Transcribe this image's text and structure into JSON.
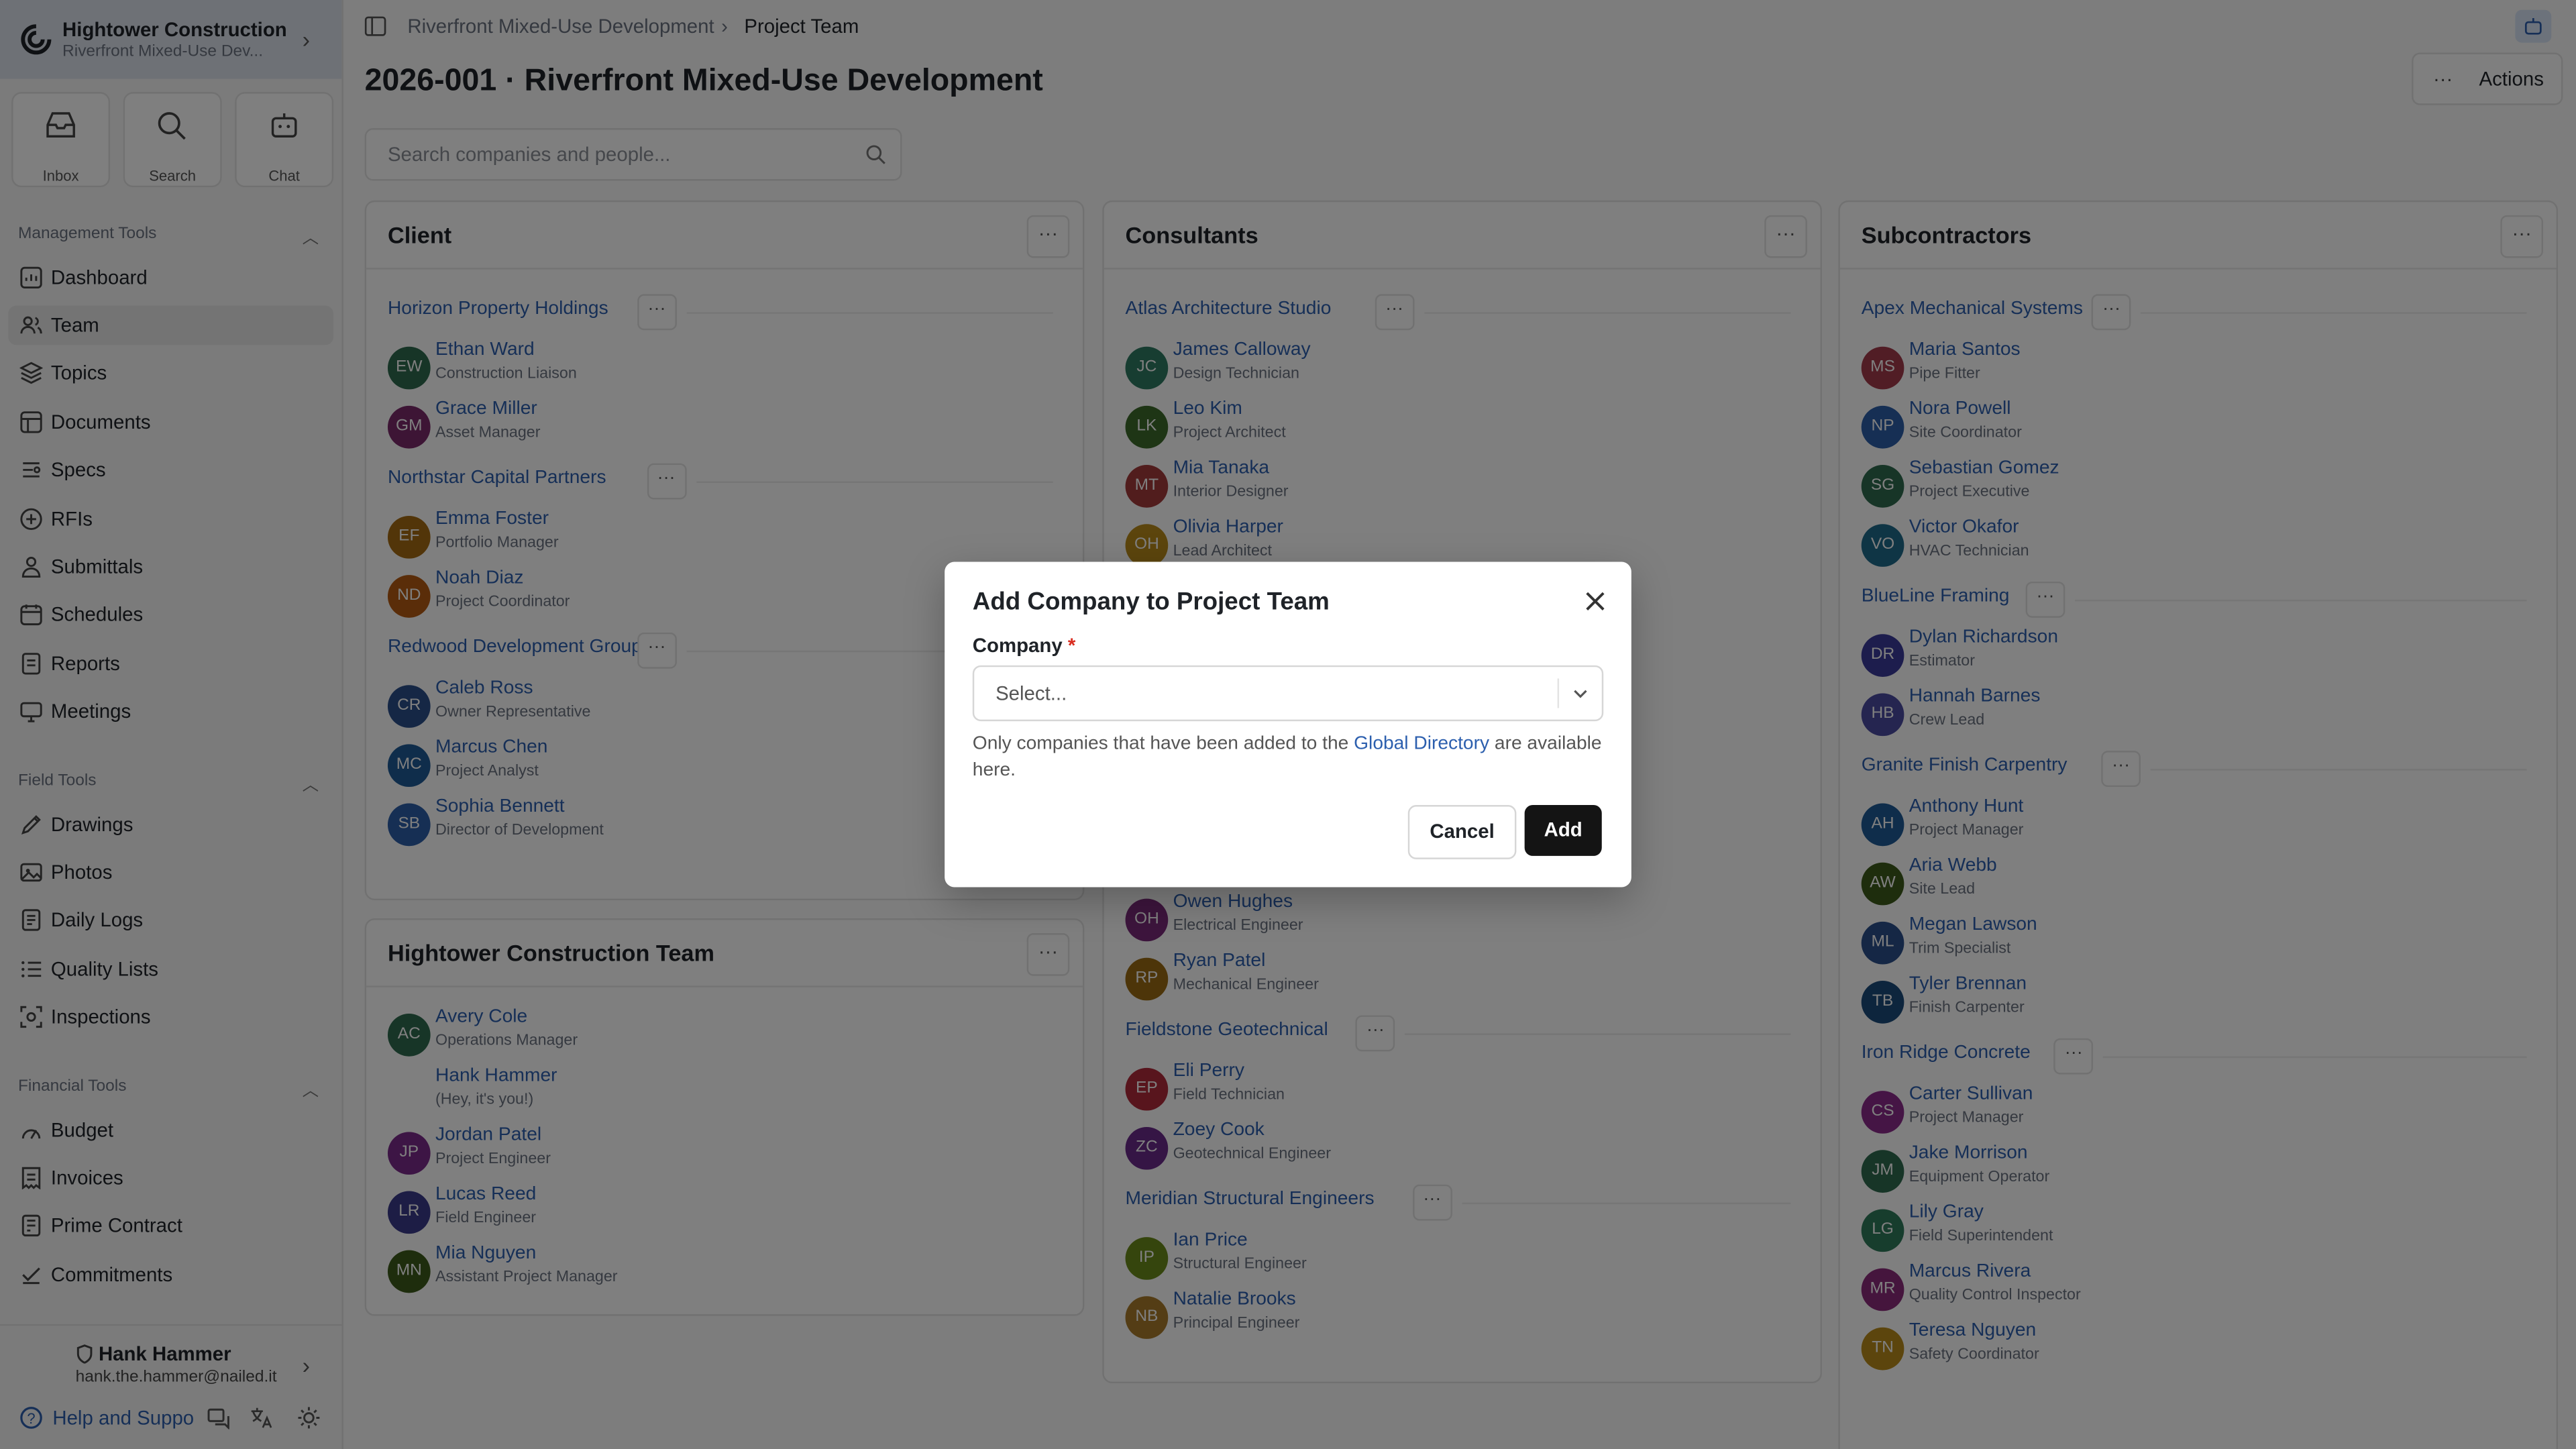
{
  "org": {
    "name": "Hightower Construction",
    "project_short": "Riverfront Mixed-Use Dev..."
  },
  "quick_actions": [
    {
      "label": "Inbox",
      "icon": "inbox-icon"
    },
    {
      "label": "Search",
      "icon": "search-icon"
    },
    {
      "label": "Chat",
      "icon": "bot-icon"
    }
  ],
  "sidebar": {
    "management": {
      "title": "Management Tools",
      "items": [
        {
          "label": "Dashboard",
          "icon": "dashboard-icon"
        },
        {
          "label": "Team",
          "icon": "users-icon",
          "active": true
        },
        {
          "label": "Topics",
          "icon": "layers-icon"
        },
        {
          "label": "Documents",
          "icon": "documents-icon"
        },
        {
          "label": "Specs",
          "icon": "specs-icon"
        },
        {
          "label": "RFIs",
          "icon": "rfi-icon"
        },
        {
          "label": "Submittals",
          "icon": "submittals-icon"
        },
        {
          "label": "Schedules",
          "icon": "calendar-icon"
        },
        {
          "label": "Reports",
          "icon": "reports-icon"
        },
        {
          "label": "Meetings",
          "icon": "meetings-icon"
        }
      ]
    },
    "field": {
      "title": "Field Tools",
      "items": [
        {
          "label": "Drawings",
          "icon": "drawings-icon"
        },
        {
          "label": "Photos",
          "icon": "photos-icon"
        },
        {
          "label": "Daily Logs",
          "icon": "daily-logs-icon"
        },
        {
          "label": "Quality Lists",
          "icon": "list-icon"
        },
        {
          "label": "Inspections",
          "icon": "inspections-icon"
        }
      ]
    },
    "financial": {
      "title": "Financial Tools",
      "items": [
        {
          "label": "Budget",
          "icon": "budget-icon"
        },
        {
          "label": "Invoices",
          "icon": "invoices-icon"
        },
        {
          "label": "Prime Contract",
          "icon": "contract-icon"
        },
        {
          "label": "Commitments",
          "icon": "commitments-icon"
        }
      ]
    }
  },
  "user": {
    "name": "Hank Hammer",
    "email": "hank.the.hammer@nailed.it",
    "help_label": "Help and Suppo"
  },
  "breadcrumb": {
    "project": "Riverfront Mixed-Use Development",
    "current": "Project Team"
  },
  "page_title": "2026-001 · Riverfront Mixed-Use Development",
  "actions_label": "Actions",
  "search_placeholder": "Search companies and people...",
  "columns": [
    {
      "title": "Client",
      "companies": [
        {
          "name": "Horizon Property Holdings",
          "people": [
            {
              "i": "EW",
              "n": "Ethan Ward",
              "r": "Construction Liaison",
              "c": "#2f6b4f"
            },
            {
              "i": "GM",
              "n": "Grace Miller",
              "r": "Asset Manager",
              "c": "#7a2a6a"
            }
          ]
        },
        {
          "name": "Northstar Capital Partners",
          "people": [
            {
              "i": "EF",
              "n": "Emma Foster",
              "r": "Portfolio Manager",
              "c": "#a46a12"
            },
            {
              "i": "ND",
              "n": "Noah Diaz",
              "r": "Project Coordinator",
              "c": "#b45a12"
            }
          ]
        },
        {
          "name": "Redwood Development Group",
          "people": [
            {
              "i": "CR",
              "n": "Caleb Ross",
              "r": "Owner Representative",
              "c": "#2b4f8a"
            },
            {
              "i": "MC",
              "n": "Marcus Chen",
              "r": "Project Analyst",
              "c": "#1f5a96"
            },
            {
              "i": "SB",
              "n": "Sophia Bennett",
              "r": "Director of Development",
              "c": "#2d5fa8"
            }
          ]
        }
      ]
    },
    {
      "title": "Consultants",
      "companies": [
        {
          "name": "Atlas Architecture Studio",
          "people": [
            {
              "i": "JC",
              "n": "James Calloway",
              "r": "Design Technician",
              "c": "#2f7a62"
            },
            {
              "i": "LK",
              "n": "Leo Kim",
              "r": "Project Architect",
              "c": "#3d6a2a"
            },
            {
              "i": "MT",
              "n": "Mia Tanaka",
              "r": "Interior Designer",
              "c": "#a33a3a"
            },
            {
              "i": "OH",
              "n": "Olivia Harper",
              "r": "Lead Architect",
              "c": "#b88a1a"
            }
          ]
        },
        {
          "name": "",
          "people": [
            {
              "i": "OH",
              "n": "Owen Hughes",
              "r": "Electrical Engineer",
              "c": "#7a2a7a"
            },
            {
              "i": "RP",
              "n": "Ryan Patel",
              "r": "Mechanical Engineer",
              "c": "#9a6a12"
            }
          ]
        },
        {
          "name": "Fieldstone Geotechnical",
          "people": [
            {
              "i": "EP",
              "n": "Eli Perry",
              "r": "Field Technician",
              "c": "#b02a3a"
            },
            {
              "i": "ZC",
              "n": "Zoey Cook",
              "r": "Geotechnical Engineer",
              "c": "#6a2a8a"
            }
          ]
        },
        {
          "name": "Meridian Structural Engineers",
          "people": [
            {
              "i": "IP",
              "n": "Ian Price",
              "r": "Structural Engineer",
              "c": "#6a8a1a"
            },
            {
              "i": "NB",
              "n": "Natalie Brooks",
              "r": "Principal Engineer",
              "c": "#a87a2a"
            }
          ]
        }
      ]
    },
    {
      "title": "Subcontractors",
      "companies": [
        {
          "name": "Apex Mechanical Systems",
          "people": [
            {
              "i": "MS",
              "n": "Maria Santos",
              "r": "Pipe Fitter",
              "c": "#a33a4a"
            },
            {
              "i": "NP",
              "n": "Nora Powell",
              "r": "Site Coordinator",
              "c": "#2d5fa8"
            },
            {
              "i": "SG",
              "n": "Sebastian Gomez",
              "r": "Project Executive",
              "c": "#2f6b4f"
            },
            {
              "i": "VO",
              "n": "Victor Okafor",
              "r": "HVAC Technician",
              "c": "#1f6a8a"
            }
          ]
        },
        {
          "name": "BlueLine Framing",
          "people": [
            {
              "i": "DR",
              "n": "Dylan Richardson",
              "r": "Estimator",
              "c": "#3a3a9a"
            },
            {
              "i": "HB",
              "n": "Hannah Barnes",
              "r": "Crew Lead",
              "c": "#4a4aa0"
            }
          ]
        },
        {
          "name": "Granite Finish Carpentry",
          "people": [
            {
              "i": "AH",
              "n": "Anthony Hunt",
              "r": "Project Manager",
              "c": "#1f5a96"
            },
            {
              "i": "AW",
              "n": "Aria Webb",
              "r": "Site Lead",
              "c": "#3d5a1a"
            },
            {
              "i": "ML",
              "n": "Megan Lawson",
              "r": "Trim Specialist",
              "c": "#2b4f8a"
            },
            {
              "i": "TB",
              "n": "Tyler Brennan",
              "r": "Finish Carpenter",
              "c": "#1a4a7a"
            }
          ]
        },
        {
          "name": "Iron Ridge Concrete",
          "people": [
            {
              "i": "CS",
              "n": "Carter Sullivan",
              "r": "Project Manager",
              "c": "#8a2a8a"
            },
            {
              "i": "JM",
              "n": "Jake Morrison",
              "r": "Equipment Operator",
              "c": "#2f6b4f"
            },
            {
              "i": "LG",
              "n": "Lily Gray",
              "r": "Field Superintendent",
              "c": "#2f7a5a"
            },
            {
              "i": "MR",
              "n": "Marcus Rivera",
              "r": "Quality Control Inspector",
              "c": "#8a2a7a"
            },
            {
              "i": "TN",
              "n": "Teresa Nguyen",
              "r": "Safety Coordinator",
              "c": "#b88a1a"
            }
          ]
        }
      ]
    }
  ],
  "team": {
    "title": "Hightower Construction Team",
    "people": [
      {
        "i": "AC",
        "n": "Avery Cole",
        "r": "Operations Manager",
        "c": "#2f6b4f"
      },
      {
        "i": "",
        "n": "Hank Hammer",
        "r": "(Hey, it's you!)",
        "c": ""
      },
      {
        "i": "JP",
        "n": "Jordan Patel",
        "r": "Project Engineer",
        "c": "#7a2a8a"
      },
      {
        "i": "LR",
        "n": "Lucas Reed",
        "r": "Field Engineer",
        "c": "#3a3a8a"
      },
      {
        "i": "MN",
        "n": "Mia Nguyen",
        "r": "Assistant Project Manager",
        "c": "#3d5a1a"
      }
    ]
  },
  "modal": {
    "title": "Add Company to Project Team",
    "field_label": "Company",
    "required_mark": "*",
    "placeholder": "Select...",
    "help_before": "Only companies that have been added to the ",
    "help_link": "Global Directory",
    "help_after": " are available here.",
    "cancel": "Cancel",
    "add": "Add"
  }
}
